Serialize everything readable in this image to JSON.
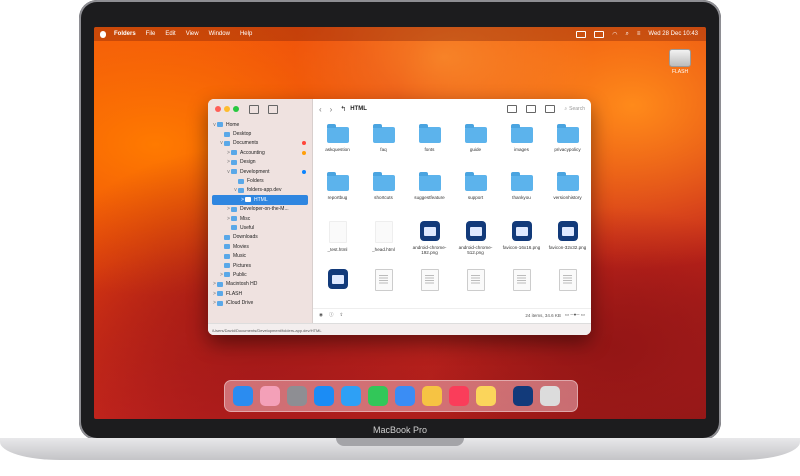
{
  "menubar": {
    "items": [
      "Folders",
      "File",
      "Edit",
      "View",
      "Window",
      "Help"
    ],
    "datetime": "Wed 28 Dec 10:43"
  },
  "desktop": {
    "drive_label": "FLASH"
  },
  "finder": {
    "title": "HTML",
    "search_placeholder": "Search",
    "sidebar": [
      {
        "label": "Home",
        "indent": 0,
        "chevron": "v"
      },
      {
        "label": "Desktop",
        "indent": 1,
        "chevron": ""
      },
      {
        "label": "Documents",
        "indent": 1,
        "chevron": "v",
        "tag": "#ff453a"
      },
      {
        "label": "Accounting",
        "indent": 2,
        "chevron": ">",
        "tag": "#ff9f0a"
      },
      {
        "label": "Design",
        "indent": 2,
        "chevron": ">"
      },
      {
        "label": "Development",
        "indent": 2,
        "chevron": "v",
        "tag": "#0a84ff"
      },
      {
        "label": "Folders",
        "indent": 3,
        "chevron": ""
      },
      {
        "label": "folders-app.dev",
        "indent": 3,
        "chevron": "v"
      },
      {
        "label": "HTML",
        "indent": 4,
        "chevron": ">",
        "selected": true
      },
      {
        "label": "Developer-on-the-M...",
        "indent": 2,
        "chevron": ">"
      },
      {
        "label": "Misc",
        "indent": 2,
        "chevron": ">"
      },
      {
        "label": "Useful",
        "indent": 2,
        "chevron": ""
      },
      {
        "label": "Downloads",
        "indent": 1,
        "chevron": ""
      },
      {
        "label": "Movies",
        "indent": 1,
        "chevron": ""
      },
      {
        "label": "Music",
        "indent": 1,
        "chevron": ""
      },
      {
        "label": "Pictures",
        "indent": 1,
        "chevron": ""
      },
      {
        "label": "Public",
        "indent": 1,
        "chevron": ">"
      },
      {
        "label": "Macintosh HD",
        "indent": 0,
        "chevron": ">"
      },
      {
        "label": "FLASH",
        "indent": 0,
        "chevron": ">"
      },
      {
        "label": "iCloud Drive",
        "indent": 0,
        "chevron": ">"
      }
    ],
    "files": [
      [
        {
          "name": "askquestion",
          "kind": "folder"
        },
        {
          "name": "faq",
          "kind": "folder"
        },
        {
          "name": "fonts",
          "kind": "folder"
        },
        {
          "name": "guide",
          "kind": "folder"
        },
        {
          "name": "images",
          "kind": "folder"
        },
        {
          "name": "privacypolicy",
          "kind": "folder"
        }
      ],
      [
        {
          "name": "reportbug",
          "kind": "folder"
        },
        {
          "name": "shortcuts",
          "kind": "folder"
        },
        {
          "name": "suggestfeature",
          "kind": "folder"
        },
        {
          "name": "support",
          "kind": "folder"
        },
        {
          "name": "thankyou",
          "kind": "folder"
        },
        {
          "name": "versionhistory",
          "kind": "folder"
        }
      ],
      [
        {
          "name": "_test.html",
          "kind": "blank"
        },
        {
          "name": "_head.html",
          "kind": "blank"
        },
        {
          "name": "android-chrome-192.png",
          "kind": "app"
        },
        {
          "name": "android-chrome-512.png",
          "kind": "app"
        },
        {
          "name": "favicon-16x16.png",
          "kind": "app"
        },
        {
          "name": "favicon-32x32.png",
          "kind": "app"
        }
      ],
      [
        {
          "name": "",
          "kind": "app"
        },
        {
          "name": "",
          "kind": "doc"
        },
        {
          "name": "",
          "kind": "doc"
        },
        {
          "name": "",
          "kind": "doc"
        },
        {
          "name": "",
          "kind": "doc"
        },
        {
          "name": "",
          "kind": "doc"
        }
      ]
    ],
    "status": "24 items, 34.6 KB",
    "path": "/Users/David/Documents/Development/folders-app.dev/HTML"
  },
  "dock": {
    "apps": [
      {
        "name": "finder-icon",
        "color": "#2b8cf0"
      },
      {
        "name": "launchpad-icon",
        "color": "#f4a0b8"
      },
      {
        "name": "system-settings-icon",
        "color": "#8e8e93"
      },
      {
        "name": "app-store-icon",
        "color": "#1b8cf5"
      },
      {
        "name": "safari-icon",
        "color": "#2ea0f5"
      },
      {
        "name": "messages-icon",
        "color": "#32c759"
      },
      {
        "name": "mail-icon",
        "color": "#3a8df5"
      },
      {
        "name": "photos-icon",
        "color": "#f6c343"
      },
      {
        "name": "music-icon",
        "color": "#fa3d5a"
      },
      {
        "name": "notes-icon",
        "color": "#fbd55b"
      },
      {
        "name": "folders-app-icon",
        "color": "#123a7a"
      },
      {
        "name": "trash-icon",
        "color": "#dcdcdc"
      }
    ]
  },
  "device": {
    "brand": "MacBook Pro"
  }
}
